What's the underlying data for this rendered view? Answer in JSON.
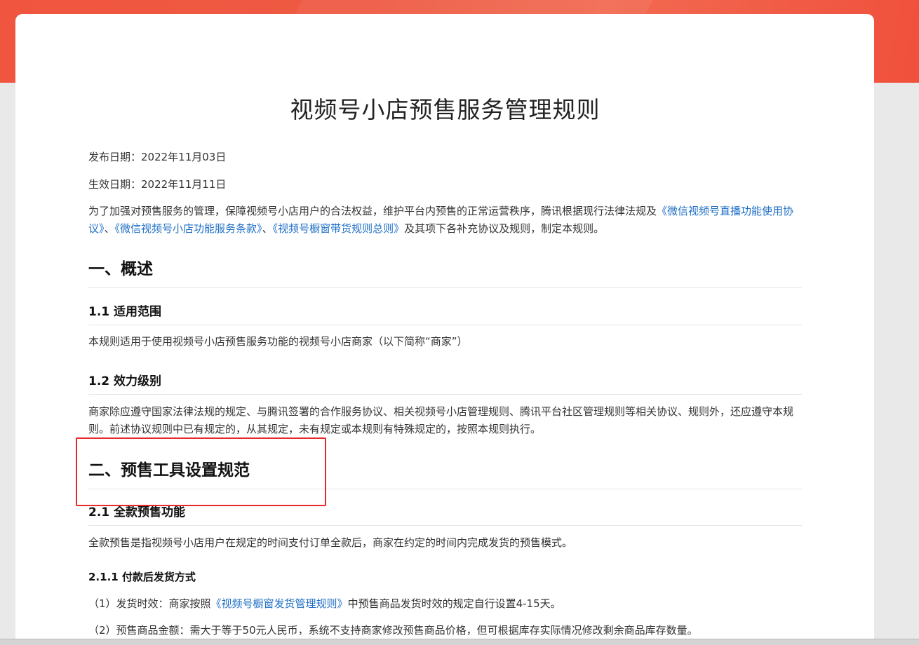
{
  "doc": {
    "title": "视频号小店预售服务管理规则",
    "publish_date": "发布日期：2022年11月03日",
    "effective_date": "生效日期：2022年11月11日",
    "intro": {
      "prefix": "为了加强对预售服务的管理，保障视频号小店用户的合法权益，维护平台内预售的正常运营秩序，腾讯根据现行法律法规及",
      "link1": "《微信视频号直播功能使用协议》",
      "sep1": "、",
      "link2": "《微信视频号小店功能服务条款》",
      "sep2": "、",
      "link3": "《视频号橱窗带货规则总则》",
      "suffix": "及其项下各补充协议及规则，制定本规则。"
    },
    "section1": {
      "heading": "一、概述",
      "sub1_heading": "1.1 适用范围",
      "sub1_text": "本规则适用于使用视频号小店预售服务功能的视频号小店商家（以下简称“商家”）",
      "sub2_heading": "1.2 效力级别",
      "sub2_text": "商家除应遵守国家法律法规的规定、与腾讯签署的合作服务协议、相关视频号小店管理规则、腾讯平台社区管理规则等相关协议、规则外，还应遵守本规则。前述协议规则中已有规定的，从其规定，未有规定或本规则有特殊规定的，按照本规则执行。"
    },
    "section2": {
      "heading": "二、预售工具设置规范",
      "sub1_heading": "2.1 全款预售功能",
      "sub1_text": "全款预售是指视频号小店用户在规定的时间支付订单全款后，商家在约定的时间内完成发货的预售模式。",
      "sub1_1_heading": "2.1.1 付款后发货方式",
      "item1": {
        "prefix": "（1）发货时效：商家按照",
        "link": "《视频号橱窗发货管理规则》",
        "suffix": "中预售商品发货时效的规定自行设置4-15天。"
      },
      "item2": "（2）预售商品金额：需大于等于50元人民币，系统不支持商家修改预售商品价格，但可根据库存实际情况修改剩余商品库存数量。"
    }
  },
  "colors": {
    "banner": "#f0553f",
    "link": "#1f6fc5",
    "highlight": "#e8282b"
  }
}
